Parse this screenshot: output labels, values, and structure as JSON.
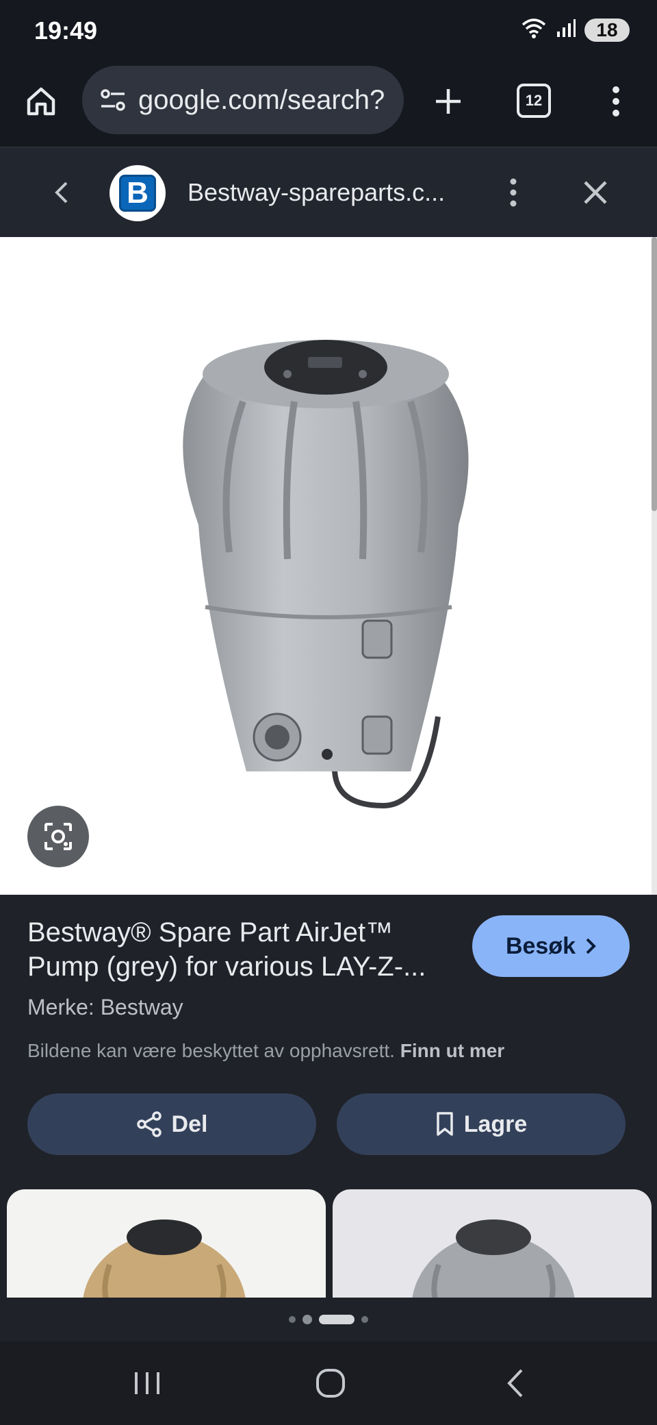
{
  "status_bar": {
    "time": "19:49",
    "battery": "18",
    "icons": [
      "wifi-icon",
      "signal-icon",
      "battery-icon"
    ]
  },
  "toolbar": {
    "url": "google.com/search?",
    "tab_count": "12",
    "icons": [
      "home-icon",
      "tune-icon",
      "plus-icon",
      "more-vert-icon"
    ]
  },
  "site": {
    "favicon_letter": "B",
    "name": "Bestway-spareparts.c...",
    "brand_color": "#0a66b8"
  },
  "product": {
    "title_line1": "Bestway® Spare Part AirJet™",
    "title_line2": "Pump (grey) for various LAY-Z-...",
    "visit_label": "Besøk",
    "brand_line": "Merke: Bestway",
    "copyright_text": "Bildene kan være beskyttet av opphavsrett.",
    "learn_more": "Finn ut mer",
    "share_label": "Del",
    "save_label": "Lagre"
  },
  "colors": {
    "accent": "#8ab4f8",
    "panel": "#1f2228",
    "action_button": "#33405a"
  }
}
